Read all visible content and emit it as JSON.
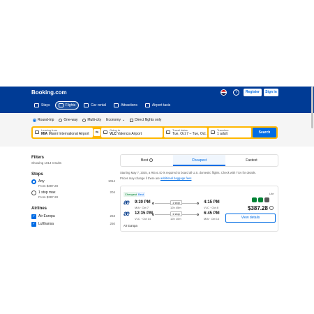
{
  "header": {
    "logo": "Booking.com",
    "register_label": "Register",
    "signin_label": "Sign in",
    "help_label": "?",
    "nav": [
      {
        "label": "Stays",
        "icon": "bed-icon"
      },
      {
        "label": "Flights",
        "icon": "plane-icon"
      },
      {
        "label": "Car rental",
        "icon": "car-icon"
      },
      {
        "label": "Attractions",
        "icon": "attractions-icon"
      },
      {
        "label": "Airport taxis",
        "icon": "taxi-icon"
      }
    ]
  },
  "search": {
    "trip_types": [
      "Round-trip",
      "One-way",
      "Multi-city"
    ],
    "selected_trip": "Round-trip",
    "cabin": "Economy",
    "direct_only_label": "Direct flights only",
    "from": {
      "label": "Leaving from",
      "code": "MIA",
      "name": "Miami International Airport"
    },
    "swap_label": "⇆",
    "to": {
      "label": "Going to",
      "code": "VLC",
      "name": "Valencia Airport"
    },
    "dates": {
      "label": "Travel dates",
      "value": "Tue, Oct 7 – Tue, Oct ..."
    },
    "travelers": {
      "label": "Travelers",
      "value": "1 adult"
    },
    "search_label": "Search"
  },
  "filters": {
    "title": "Filters",
    "results": "Showing 1014 results",
    "stops_title": "Stops",
    "stops": [
      {
        "label": "Any",
        "count": "1014",
        "from": "From $387.28",
        "selected": true
      },
      {
        "label": "1 stop max",
        "count": "204",
        "from": "From $387.28",
        "selected": false
      }
    ],
    "airlines_title": "Airlines",
    "airlines": [
      {
        "label": "Air Europa",
        "count": "263"
      },
      {
        "label": "Lufthansa",
        "count": "250"
      }
    ]
  },
  "sort_tabs": {
    "best": "Best",
    "cheapest": "Cheapest",
    "fastest": "Fastest",
    "active": "Cheapest"
  },
  "notice": {
    "line1": "Starting May 7, 2025, a REAL ID is required to board all U.S. domestic flights. Check with TSA for details.",
    "line2_text": "Prices may change if there are",
    "line2_link": "additional baggage fees"
  },
  "flight": {
    "badge_cheapest": "Cheapest",
    "badge_best": "Best",
    "fare_type": "Lite",
    "outbound": {
      "depart_time": "9:30 PM",
      "depart_sub": "MIA · Oct 7",
      "stops": "1 stop",
      "duration": "12h 45m",
      "arrive_time": "4:15 PM",
      "arrive_sub": "VLC · Oct 8"
    },
    "return": {
      "depart_time": "12:35 PM",
      "depart_sub": "VLC · Oct 14",
      "stops": "1 stop",
      "duration": "12h 10m",
      "arrive_time": "6:45 PM",
      "arrive_sub": "MIA · Oct 14"
    },
    "price": "$387.28",
    "details_label": "View details",
    "carrier": "Air Europa"
  }
}
